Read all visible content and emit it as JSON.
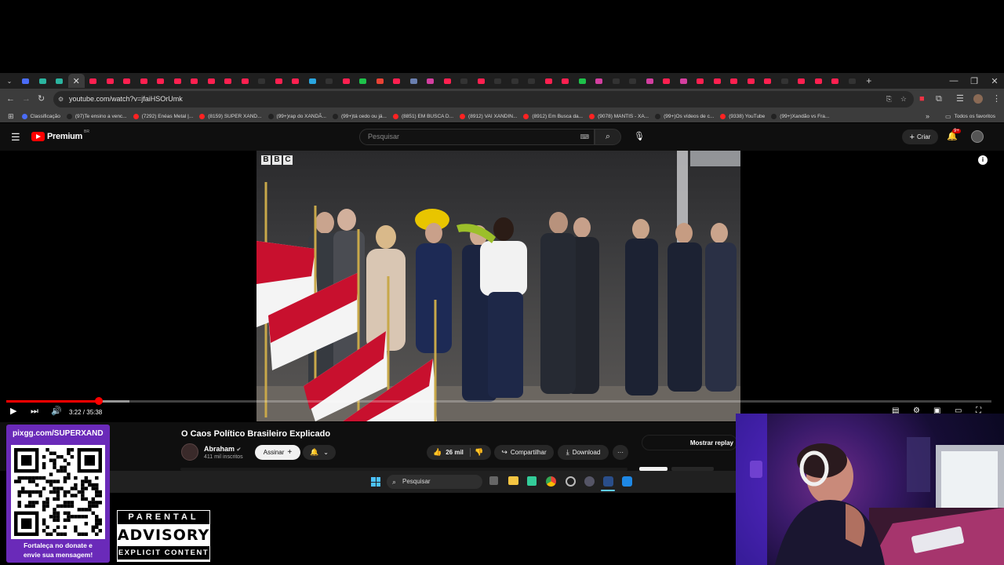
{
  "browser": {
    "tab_close": "✕",
    "new_tab": "+",
    "tabs_extra": 49,
    "url": "youtube.com/watch?v=jfaiHSOrUmk",
    "bookmarks": [
      {
        "label": "Classificação",
        "color": "#4a6cf7"
      },
      {
        "label": "(97)Te ensino a venc...",
        "color": "#222"
      },
      {
        "label": "(7292) Enéas Metal |...",
        "color": "#f22"
      },
      {
        "label": "(8159) SUPER XAND...",
        "color": "#f22"
      },
      {
        "label": "(99+)rap do XANDÃ...",
        "color": "#222"
      },
      {
        "label": "(99+)tá cedo ou já...",
        "color": "#222"
      },
      {
        "label": "(8851) EM BUSCA D...",
        "color": "#f22"
      },
      {
        "label": "(8912) VAI XANDIN...",
        "color": "#f22"
      },
      {
        "label": "(8912) Em Busca da...",
        "color": "#f22"
      },
      {
        "label": "(9078) MANTIS - XA...",
        "color": "#f22"
      },
      {
        "label": "(99+)Os vídeos de c...",
        "color": "#222"
      },
      {
        "label": "(9338) YouTube",
        "color": "#f22"
      },
      {
        "label": "(99+)Xandão vs Fra...",
        "color": "#222"
      }
    ],
    "bookmarks_folder": "Todos os favoritos"
  },
  "youtube": {
    "logo": "Premium",
    "region": "BR",
    "search_placeholder": "Pesquisar",
    "create_label": "Criar",
    "notif_count": "9+",
    "video": {
      "watermark": "BBC",
      "time": "3:22 / 35:38",
      "progress": 0.094,
      "buffered": 0.125
    },
    "title": "O Caos Político Brasileiro Explicado",
    "channel": "Abraham",
    "subs": "411 mil inscritos",
    "subscribe": "Assinar",
    "likes": "26 mil",
    "share": "Compartilhar",
    "download": "Download",
    "more": "···",
    "replay": "Mostrar replay"
  },
  "taskbar": {
    "search": "Pesquisar"
  },
  "overlay": {
    "qr_url": "pixgg.com/SUPERXAND",
    "qr_msg_1": "Fortaleça no donate e",
    "qr_msg_2": "envie sua mensagem!",
    "adv_1": "PARENTAL",
    "adv_2": "ADVISORY",
    "adv_3": "EXPLICIT CONTENT"
  },
  "colors": {
    "yt_red": "#ff0000",
    "qr_purple": "#6a2ab9"
  }
}
